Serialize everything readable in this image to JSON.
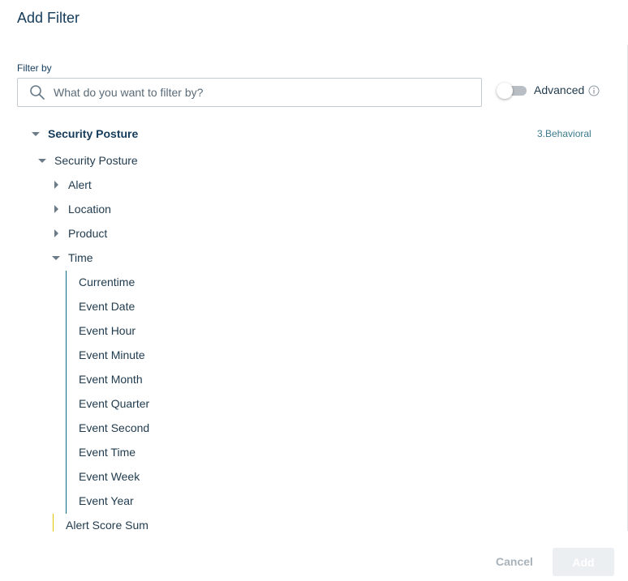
{
  "dialog": {
    "title": "Add Filter",
    "filter_label": "Filter by",
    "search": {
      "placeholder": "What do you want to filter by?",
      "value": ""
    },
    "advanced": {
      "label": "Advanced",
      "enabled": false
    }
  },
  "tree": {
    "root": {
      "label": "Security Posture",
      "expanded": true,
      "tag": "3.Behavioral"
    },
    "group": {
      "label": "Security Posture",
      "expanded": true
    },
    "categories": [
      {
        "label": "Alert",
        "expanded": false
      },
      {
        "label": "Location",
        "expanded": false
      },
      {
        "label": "Product",
        "expanded": false
      },
      {
        "label": "Time",
        "expanded": true
      }
    ],
    "time_items": [
      "Currentime",
      "Event Date",
      "Event Hour",
      "Event Minute",
      "Event Month",
      "Event Quarter",
      "Event Second",
      "Event Time",
      "Event Week",
      "Event Year"
    ],
    "measure": {
      "label": "Alert Score Sum"
    }
  },
  "footer": {
    "cancel_label": "Cancel",
    "add_label": "Add"
  },
  "colors": {
    "accent": "#0e6c8a",
    "measure_line": "#e0c400",
    "title": "#143b5a",
    "disabled_button": "#eceff2"
  },
  "icons": {
    "search": "search-icon",
    "info": "info-icon",
    "expanded": "caret-down-icon",
    "collapsed": "caret-right-icon"
  }
}
